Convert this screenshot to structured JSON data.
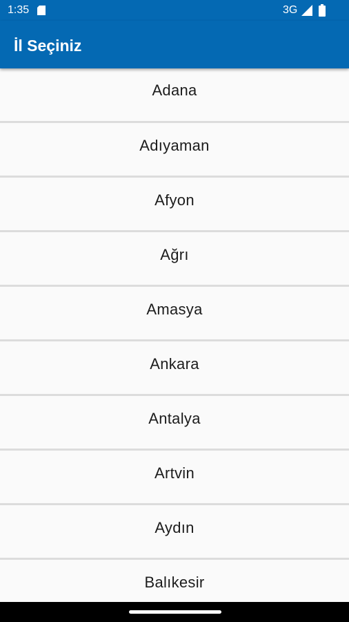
{
  "status_bar": {
    "time": "1:35",
    "network": "3G",
    "icons": [
      "sd-card-icon",
      "signal-icon",
      "battery-icon"
    ]
  },
  "app_bar": {
    "title": "İl Seçiniz"
  },
  "cities": [
    {
      "label": "Adana"
    },
    {
      "label": "Adıyaman"
    },
    {
      "label": "Afyon"
    },
    {
      "label": "Ağrı"
    },
    {
      "label": "Amasya"
    },
    {
      "label": "Ankara"
    },
    {
      "label": "Antalya"
    },
    {
      "label": "Artvin"
    },
    {
      "label": "Aydın"
    },
    {
      "label": "Balıkesir"
    }
  ],
  "colors": {
    "primary": "#0469b3",
    "list_background": "#fafafa",
    "divider": "#dcdcdc",
    "text": "#1c1c1c"
  }
}
